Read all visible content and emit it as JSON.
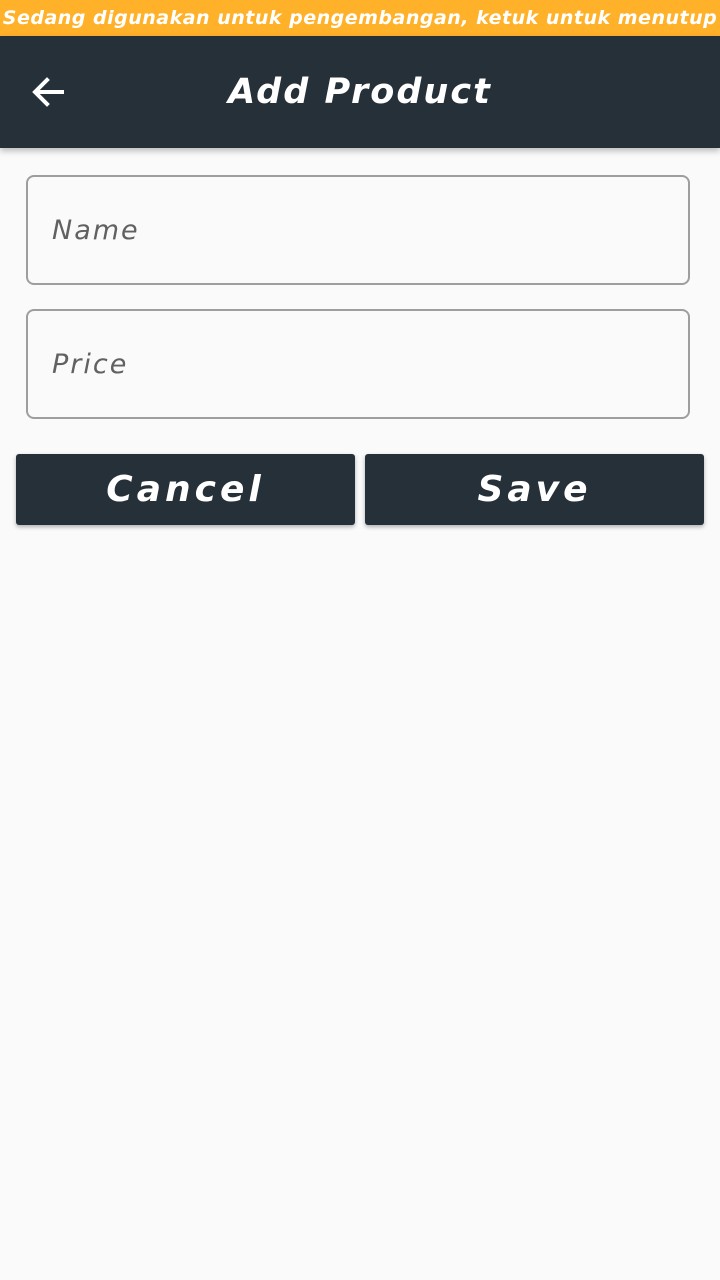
{
  "dev_banner": {
    "text": "Sedang digunakan untuk pengembangan, ketuk untuk menutup"
  },
  "app_bar": {
    "title": "Add Product",
    "back_icon": "arrow-left-icon"
  },
  "form": {
    "name_placeholder": "Name",
    "name_value": "",
    "price_placeholder": "Price",
    "price_value": ""
  },
  "actions": {
    "cancel_label": "Cancel",
    "save_label": "Save"
  },
  "colors": {
    "banner": "#FFB12A",
    "app_bar": "#263039",
    "background": "#FAFAFA",
    "field_border": "#9E9E9E",
    "button": "#263039"
  }
}
